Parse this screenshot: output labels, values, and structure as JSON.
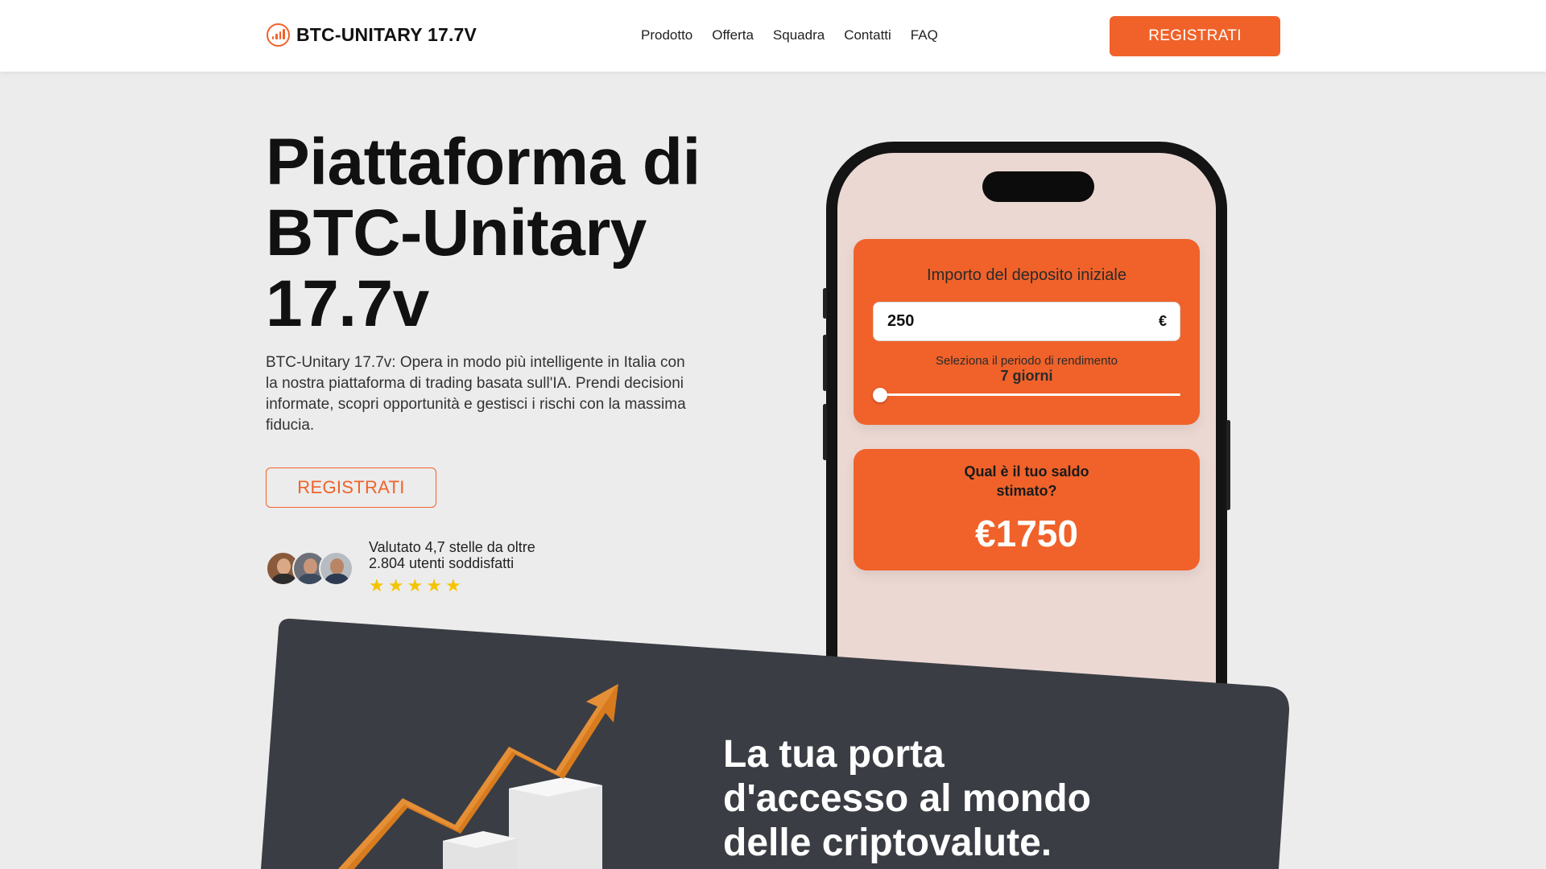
{
  "brand": {
    "name": "BTC-UNITARY 17.7V",
    "accent": "#f0622a",
    "dark": "#3a3d44"
  },
  "nav": {
    "links": [
      "Prodotto",
      "Offerta",
      "Squadra",
      "Contatti",
      "FAQ"
    ],
    "cta": "REGISTRATI"
  },
  "hero": {
    "title": "Piattaforma di BTC-Unitary 17.7v",
    "description": "BTC-Unitary 17.7v: Opera in modo più intelligente in Italia con la nostra piattaforma di trading basata sull'IA. Prendi decisioni informate, scopri opportunità e gestisci i rischi con la massima fiducia.",
    "cta": "REGISTRATI",
    "rating": {
      "line1": "Valutato 4,7 stelle da oltre",
      "line2": "2.804 utenti soddisfatti",
      "stars": 5,
      "star_glyph": "★"
    }
  },
  "calculator": {
    "deposit_label": "Importo del deposito iniziale",
    "deposit_value": "250",
    "currency": "€",
    "period_label": "Seleziona il periodo di rendimento",
    "period_value": "7 giorni",
    "slider_position": 0,
    "result_question": "Qual è il tuo saldo stimato?",
    "result_value": "€1750"
  },
  "section2": {
    "title": "La tua porta d'accesso al mondo delle criptovalute."
  }
}
